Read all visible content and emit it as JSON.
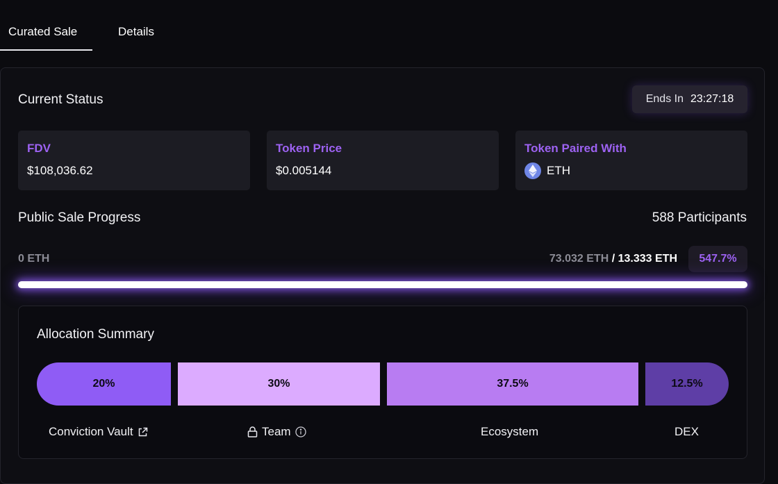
{
  "tabs": {
    "curated_sale": "Curated Sale",
    "details": "Details"
  },
  "status": {
    "title": "Current Status",
    "ends_label": "Ends In",
    "ends_time": "23:27:18"
  },
  "stats": {
    "fdv_label": "FDV",
    "fdv_value": "$108,036.62",
    "price_label": "Token Price",
    "price_value": "$0.005144",
    "paired_label": "Token Paired With",
    "paired_value": "ETH",
    "paired_icon": "ethereum-icon"
  },
  "progress": {
    "title": "Public Sale Progress",
    "participants": "588 Participants",
    "start": "0 ETH",
    "raised": "73.032 ETH",
    "separator": " / ",
    "goal": "13.333 ETH",
    "percent_label": "547.7%",
    "fill_fraction": 1.0
  },
  "allocation": {
    "title": "Allocation Summary",
    "segments": [
      {
        "percent": "20%",
        "label": "Conviction Vault",
        "icon": "external-link-icon"
      },
      {
        "percent": "30%",
        "label": "Team",
        "icon": "lock-icon",
        "info_icon": "info-icon"
      },
      {
        "percent": "37.5%",
        "label": "Ecosystem"
      },
      {
        "percent": "12.5%",
        "label": "DEX"
      }
    ]
  },
  "colors": {
    "accent": "#9d62f2",
    "segment_1": "#8f5cf5",
    "segment_2": "#dcabff",
    "segment_3": "#b87cf2",
    "segment_4": "#5e3ea6"
  }
}
